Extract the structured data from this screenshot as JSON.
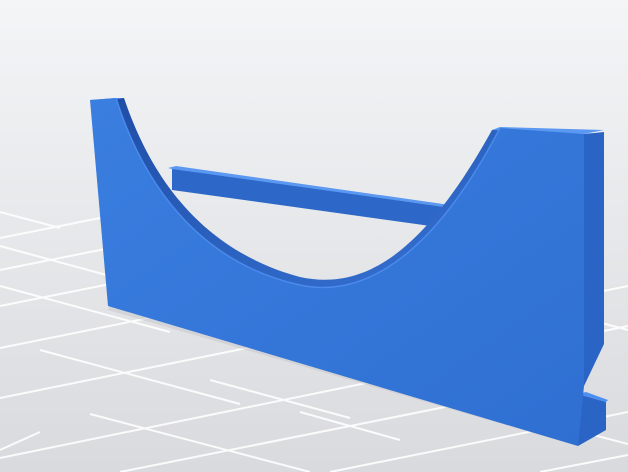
{
  "scene": {
    "subject": "blue-3d-printed-cradle-part",
    "colors": {
      "background_top": "#f4f5f7",
      "background_bottom": "#d9dadd",
      "grid_line": "#ffffff",
      "part_front": "#3a7ee0",
      "part_front_dark": "#2f6fd2",
      "part_top": "#4b8ff0",
      "part_side": "#2a64c4",
      "part_back": "#2d68c8",
      "inner_curve": "#2557b0",
      "shadow": "#c9cace"
    }
  }
}
